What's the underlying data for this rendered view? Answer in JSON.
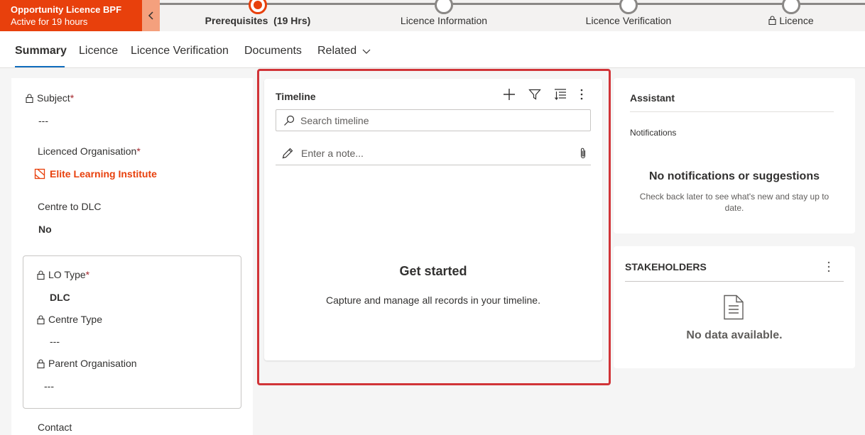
{
  "bpf": {
    "title": "Opportunity Licence BPF",
    "status": "Active for 19 hours",
    "stages": [
      {
        "label": "Prerequisites",
        "duration": "(19 Hrs)"
      },
      {
        "label": "Licence Information"
      },
      {
        "label": "Licence Verification"
      },
      {
        "label": "Licence"
      }
    ]
  },
  "tabs": [
    "Summary",
    "Licence",
    "Licence Verification",
    "Documents",
    "Related"
  ],
  "form": {
    "subject_label": "Subject",
    "subject_value": "---",
    "licenced_org_label": "Licenced Organisation",
    "licenced_org_value": "Elite Learning Institute",
    "centre_dlc_label": "Centre to DLC",
    "centre_dlc_value": "No",
    "lo_type_label": "LO Type",
    "lo_type_value": "DLC",
    "centre_type_label": "Centre Type",
    "centre_type_value": "---",
    "parent_org_label": "Parent Organisation",
    "parent_org_value": "---",
    "contact_label": "Contact",
    "required_marker": "*"
  },
  "timeline": {
    "title": "Timeline",
    "search_placeholder": "Search timeline",
    "note_placeholder": "Enter a note...",
    "empty_title": "Get started",
    "empty_subtitle": "Capture and manage all records in your timeline."
  },
  "assistant": {
    "title": "Assistant",
    "notifications_label": "Notifications",
    "empty_title": "No notifications or suggestions",
    "empty_subtitle": "Check back later to see what's new and stay up to date."
  },
  "stakeholders": {
    "title": "STAKEHOLDERS",
    "empty": "No data available."
  },
  "colors": {
    "accent": "#e8400c",
    "highlight": "#d13438",
    "link": "#e8400c"
  }
}
